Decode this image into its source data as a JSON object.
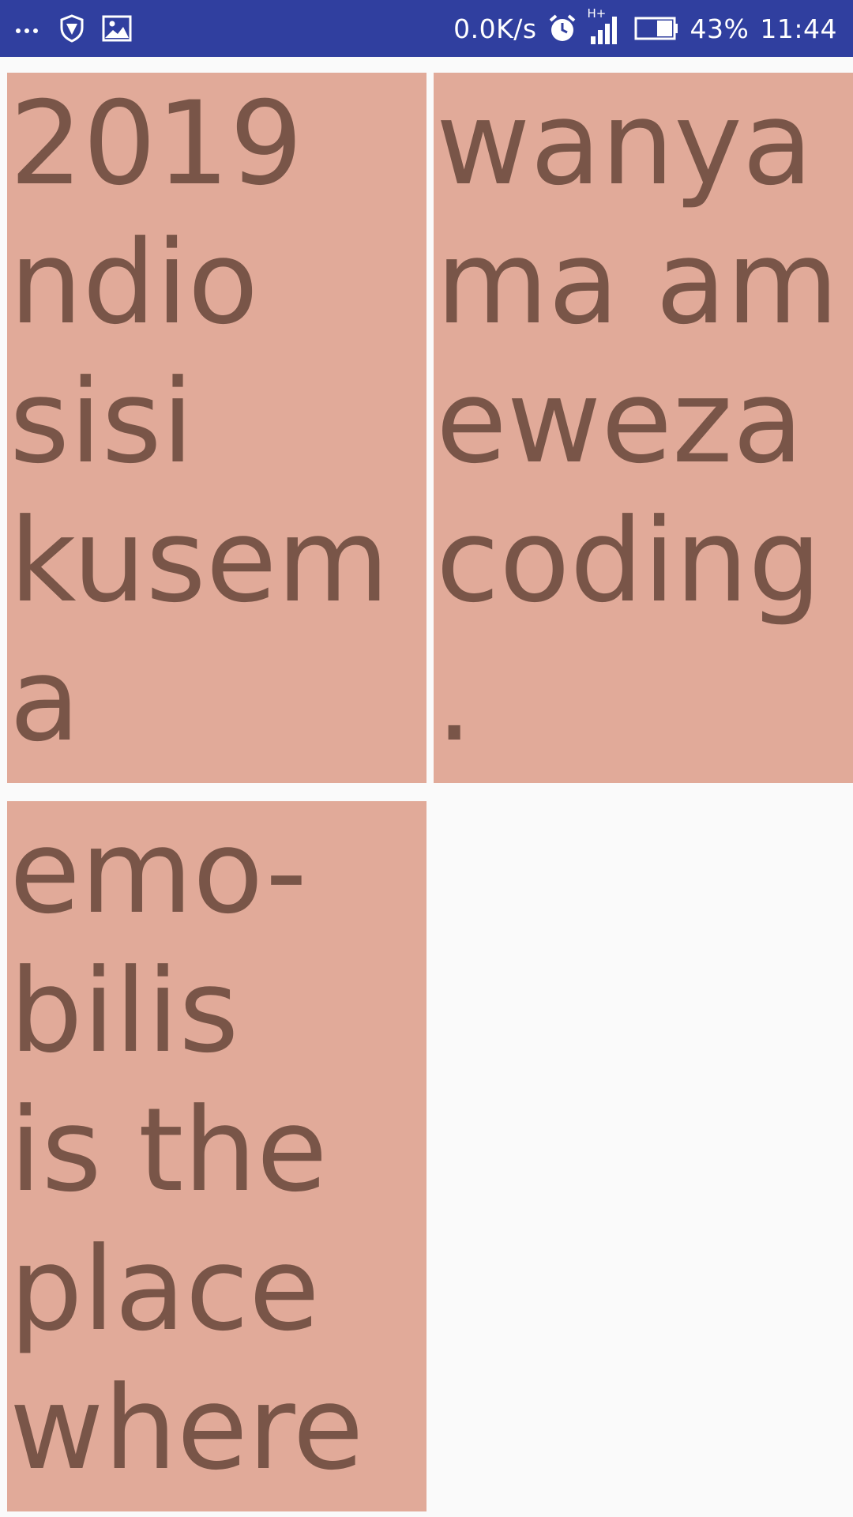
{
  "status_bar": {
    "network_speed": "0.0K/s",
    "network_type": "H+",
    "battery": "43%",
    "time": "11:44",
    "icons": [
      "more-dots-icon",
      "shield-icon",
      "gallery-icon",
      "alarm-icon",
      "signal-icon",
      "battery-icon"
    ]
  },
  "tiles": [
    {
      "text": "2019\nndio\nsisi\nkusema"
    },
    {
      "text": "wanya\nma am\neweza\ncoding."
    },
    {
      "text": "emo-\nbilis\nis the\nplace\nwhere"
    }
  ],
  "colors": {
    "status_bar": "#303f9f",
    "tile_background": "#e1aa99",
    "tile_text": "#795548",
    "page_background": "#fafafa"
  }
}
